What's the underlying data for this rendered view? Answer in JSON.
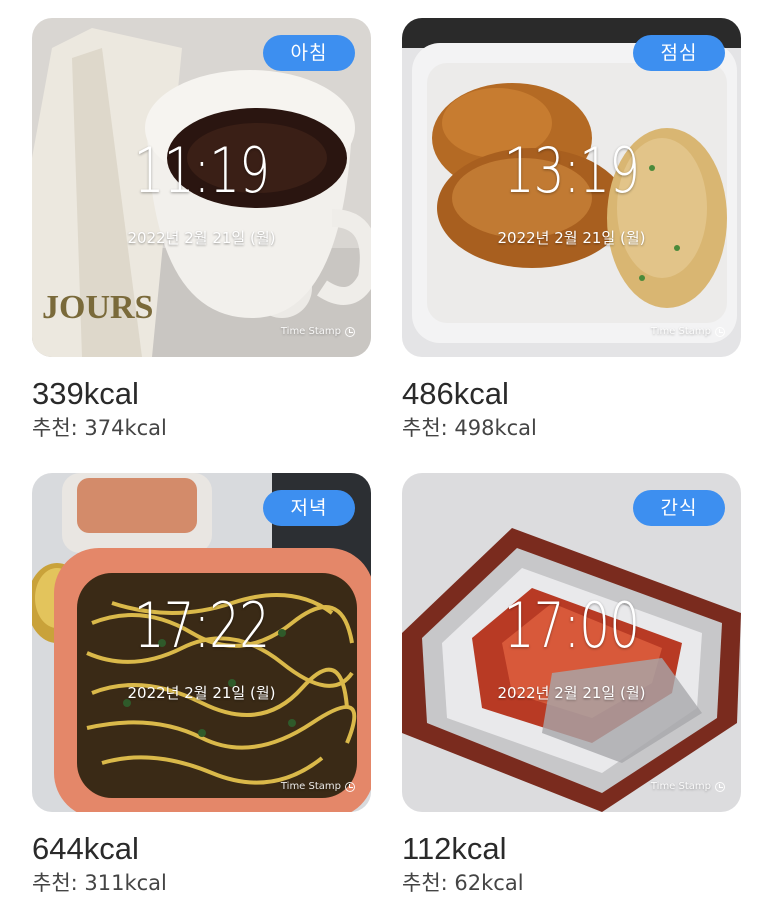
{
  "meals": [
    {
      "badge": "아침",
      "time": "11:19",
      "date": "2022년 2월 21일 (월)",
      "stamp": "Time Stamp",
      "kcal": "339kcal",
      "recommended": "추천: 374kcal"
    },
    {
      "badge": "점심",
      "time": "13:19",
      "date": "2022년 2월 21일 (월)",
      "stamp": "Time Stamp",
      "kcal": "486kcal",
      "recommended": "추천: 498kcal"
    },
    {
      "badge": "저녁",
      "time": "17:22",
      "date": "2022년 2월 21일 (월)",
      "stamp": "Time Stamp",
      "kcal": "644kcal",
      "recommended": "추천: 311kcal"
    },
    {
      "badge": "간식",
      "time": "17:00",
      "date": "2022년 2월 21일 (월)",
      "stamp": "Time Stamp",
      "kcal": "112kcal",
      "recommended": "추천: 62kcal"
    }
  ],
  "colors": {
    "badge": "#3d8ff0",
    "text": "#2a2a2a"
  },
  "photo_icons": [
    "coffee-photo",
    "fried-chicken-photo",
    "ramen-photo",
    "snack-photo"
  ]
}
